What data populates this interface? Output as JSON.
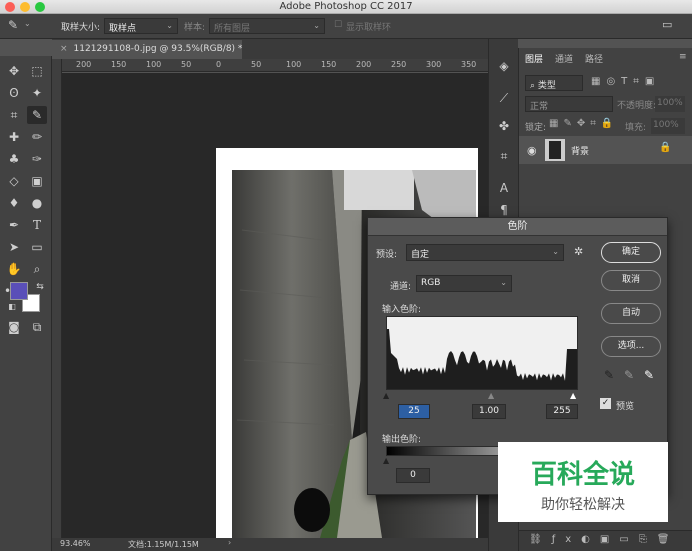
{
  "window": {
    "title": "Adobe Photoshop CC 2017"
  },
  "options": {
    "sample_size_label": "取样大小:",
    "sample_size_value": "取样点",
    "sample_label": "样本:",
    "sample_value": "所有图层",
    "show_ring_label": "显示取样环"
  },
  "document": {
    "tab_label": "1121291108-0.jpg @ 93.5%(RGB/8) *",
    "ruler_ticks": [
      "200",
      "150",
      "100",
      "50",
      "0",
      "50",
      "100",
      "150",
      "200",
      "250",
      "300",
      "350"
    ]
  },
  "status": {
    "zoom": "93.46%",
    "doc_size": "文档:1.15M/1.15M"
  },
  "layers_panel": {
    "tabs": [
      "图层",
      "通道",
      "路径"
    ],
    "filter_label": "类型",
    "blend_mode": "正常",
    "opacity_label": "不透明度:",
    "opacity_value": "100%",
    "lock_label": "锁定:",
    "fill_label": "填充:",
    "fill_value": "100%",
    "layer_name": "背景"
  },
  "levels": {
    "title": "色阶",
    "preset_label": "预设:",
    "preset_value": "自定",
    "channel_label": "通道:",
    "channel_value": "RGB",
    "input_label": "输入色阶:",
    "input_black": "25",
    "input_gamma": "1.00",
    "input_white": "255",
    "output_label": "输出色阶:",
    "output_black": "0",
    "buttons": {
      "ok": "确定",
      "cancel": "取消",
      "auto": "自动",
      "options": "选项..."
    },
    "preview_label": "预览",
    "preview_checked": true
  },
  "watermark": {
    "title": "百科全说",
    "subtitle": "助你轻松解决"
  },
  "colors": {
    "foreground": "#5a4fb8",
    "background": "#ffffff",
    "watermark_green": "#27a95a"
  }
}
